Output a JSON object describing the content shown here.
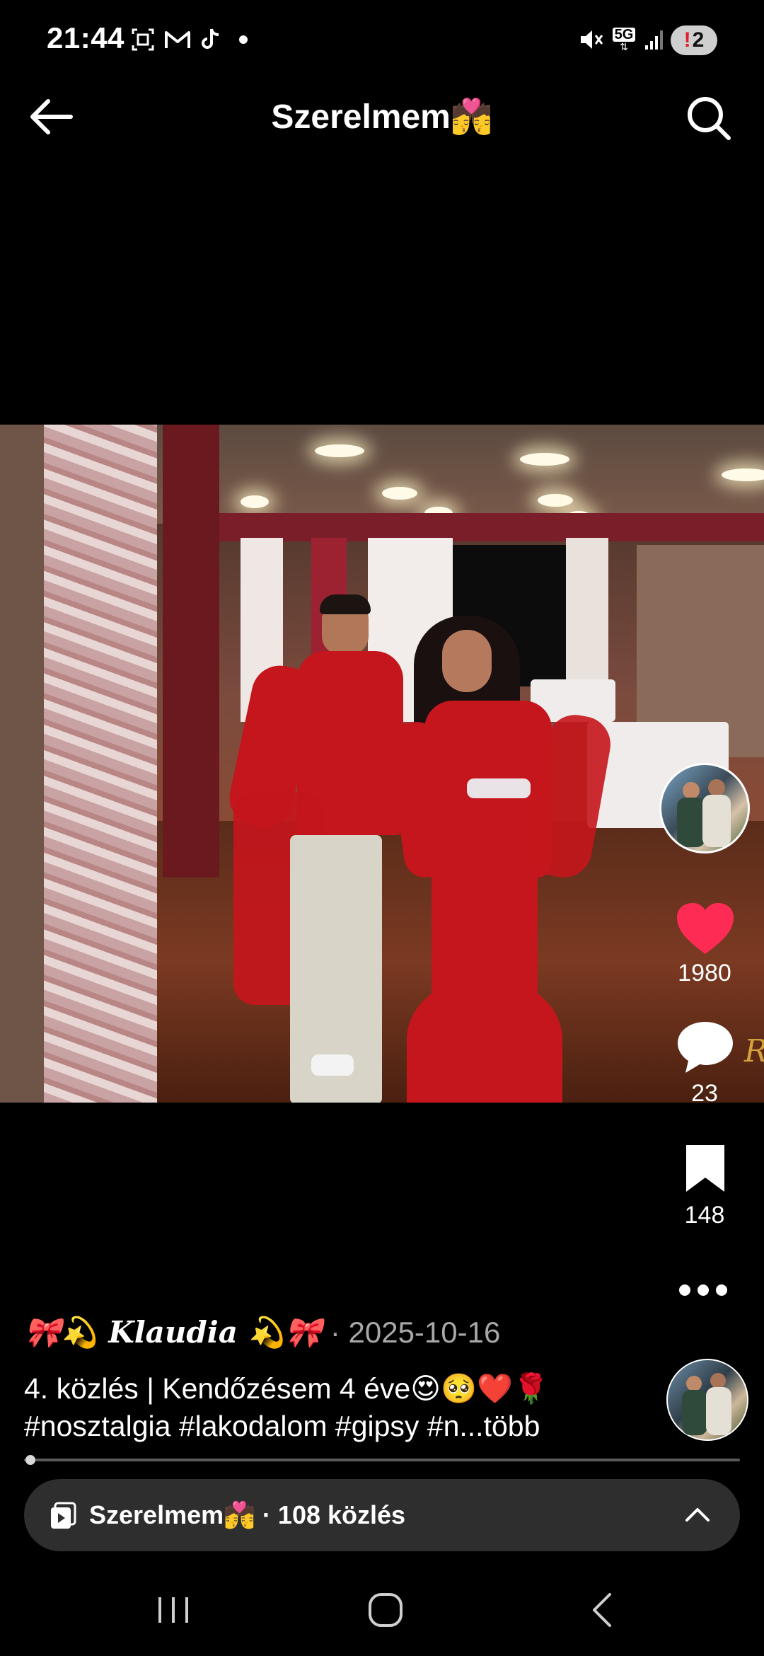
{
  "status_bar": {
    "time": "21:44",
    "notification_icons": [
      "screenshot-icon",
      "gmail-icon",
      "tiktok-icon",
      "dot-icon"
    ],
    "network_label": "5G",
    "battery_badge": "2",
    "battery_warning": "!"
  },
  "header": {
    "title": "Szerelmem💏"
  },
  "right_rail": {
    "like_count": "1980",
    "comment_count": "23",
    "save_count": "148",
    "like_color": "#fe2c55"
  },
  "caption": {
    "author": "🎀💫 𝑲𝒍𝒂𝒖𝒅𝒊𝒂 💫🎀",
    "separator": " · ",
    "date": "2025-10-16",
    "line1": "4. közlés | Kendőzésem 4 éve😍🥺❤️🌹",
    "line2": "#nosztalgia #lakodalom #gipsy #n...több"
  },
  "playlist": {
    "label": "Szerelmem💏 · 108 közlés"
  },
  "watermark_text": "R"
}
